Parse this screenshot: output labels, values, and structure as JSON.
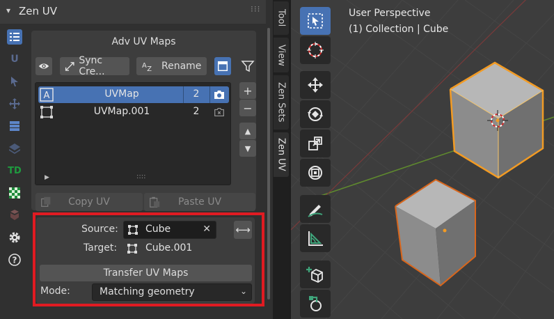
{
  "panel": {
    "title": "Zen UV",
    "collapse_icon": "▾",
    "grip": "⁝⁝⁝"
  },
  "sidebar_icons": [
    {
      "name": "zen-uv-menu-icon",
      "active": true
    },
    {
      "name": "uv-icon",
      "text": "U"
    },
    {
      "name": "select-icon"
    },
    {
      "name": "transform-icon"
    },
    {
      "name": "adv-uv-maps-icon"
    },
    {
      "name": "layers-icon"
    },
    {
      "name": "texel-density-icon",
      "text": "TD"
    },
    {
      "name": "checker-icon"
    },
    {
      "name": "stack-icon"
    },
    {
      "name": "settings-icon"
    },
    {
      "name": "help-icon"
    }
  ],
  "adv_uv_maps": {
    "title": "Adv UV Maps",
    "sync_label": "Sync Cre...",
    "rename_label": "Rename",
    "uv_maps": [
      {
        "name": "UVMap",
        "count": "2",
        "active": true
      },
      {
        "name": "UVMap.001",
        "count": "2",
        "active": false
      }
    ],
    "add": "+",
    "remove": "−",
    "move_up": "▲",
    "move_down": "▼",
    "list_expand": "▶",
    "list_grip": "::::",
    "copy_uv_label": "Copy UV",
    "paste_uv_label": "Paste UV"
  },
  "transfer": {
    "source_label": "Source:",
    "source_value": "Cube",
    "source_clear": "✕",
    "swap": "⟷",
    "target_label": "Target:",
    "target_value": "Cube.001",
    "button_label": "Transfer UV Maps",
    "mode_label": "Mode:",
    "mode_value": "Matching geometry",
    "mode_chevron": "⌄",
    "highlight_color": "#e01b22"
  },
  "side_tabs": [
    {
      "label": "Tool",
      "active": false
    },
    {
      "label": "View",
      "active": false
    },
    {
      "label": "Zen Sets",
      "active": false
    },
    {
      "label": "Zen UV",
      "active": true
    }
  ],
  "viewport": {
    "perspective": "User Perspective",
    "collection": "(1) Collection | Cube",
    "tools": [
      "select-box-icon",
      "cursor-icon",
      "move-icon",
      "rotate-icon",
      "scale-icon",
      "transform-icon",
      "annotate-icon",
      "measure-icon",
      "add-cube-icon",
      "spin-icon"
    ]
  },
  "colors": {
    "accent": "#4772b3",
    "panel_bg": "#303030",
    "viewport_bg": "#3d3d3d",
    "selection_outline": "#f29b24"
  }
}
